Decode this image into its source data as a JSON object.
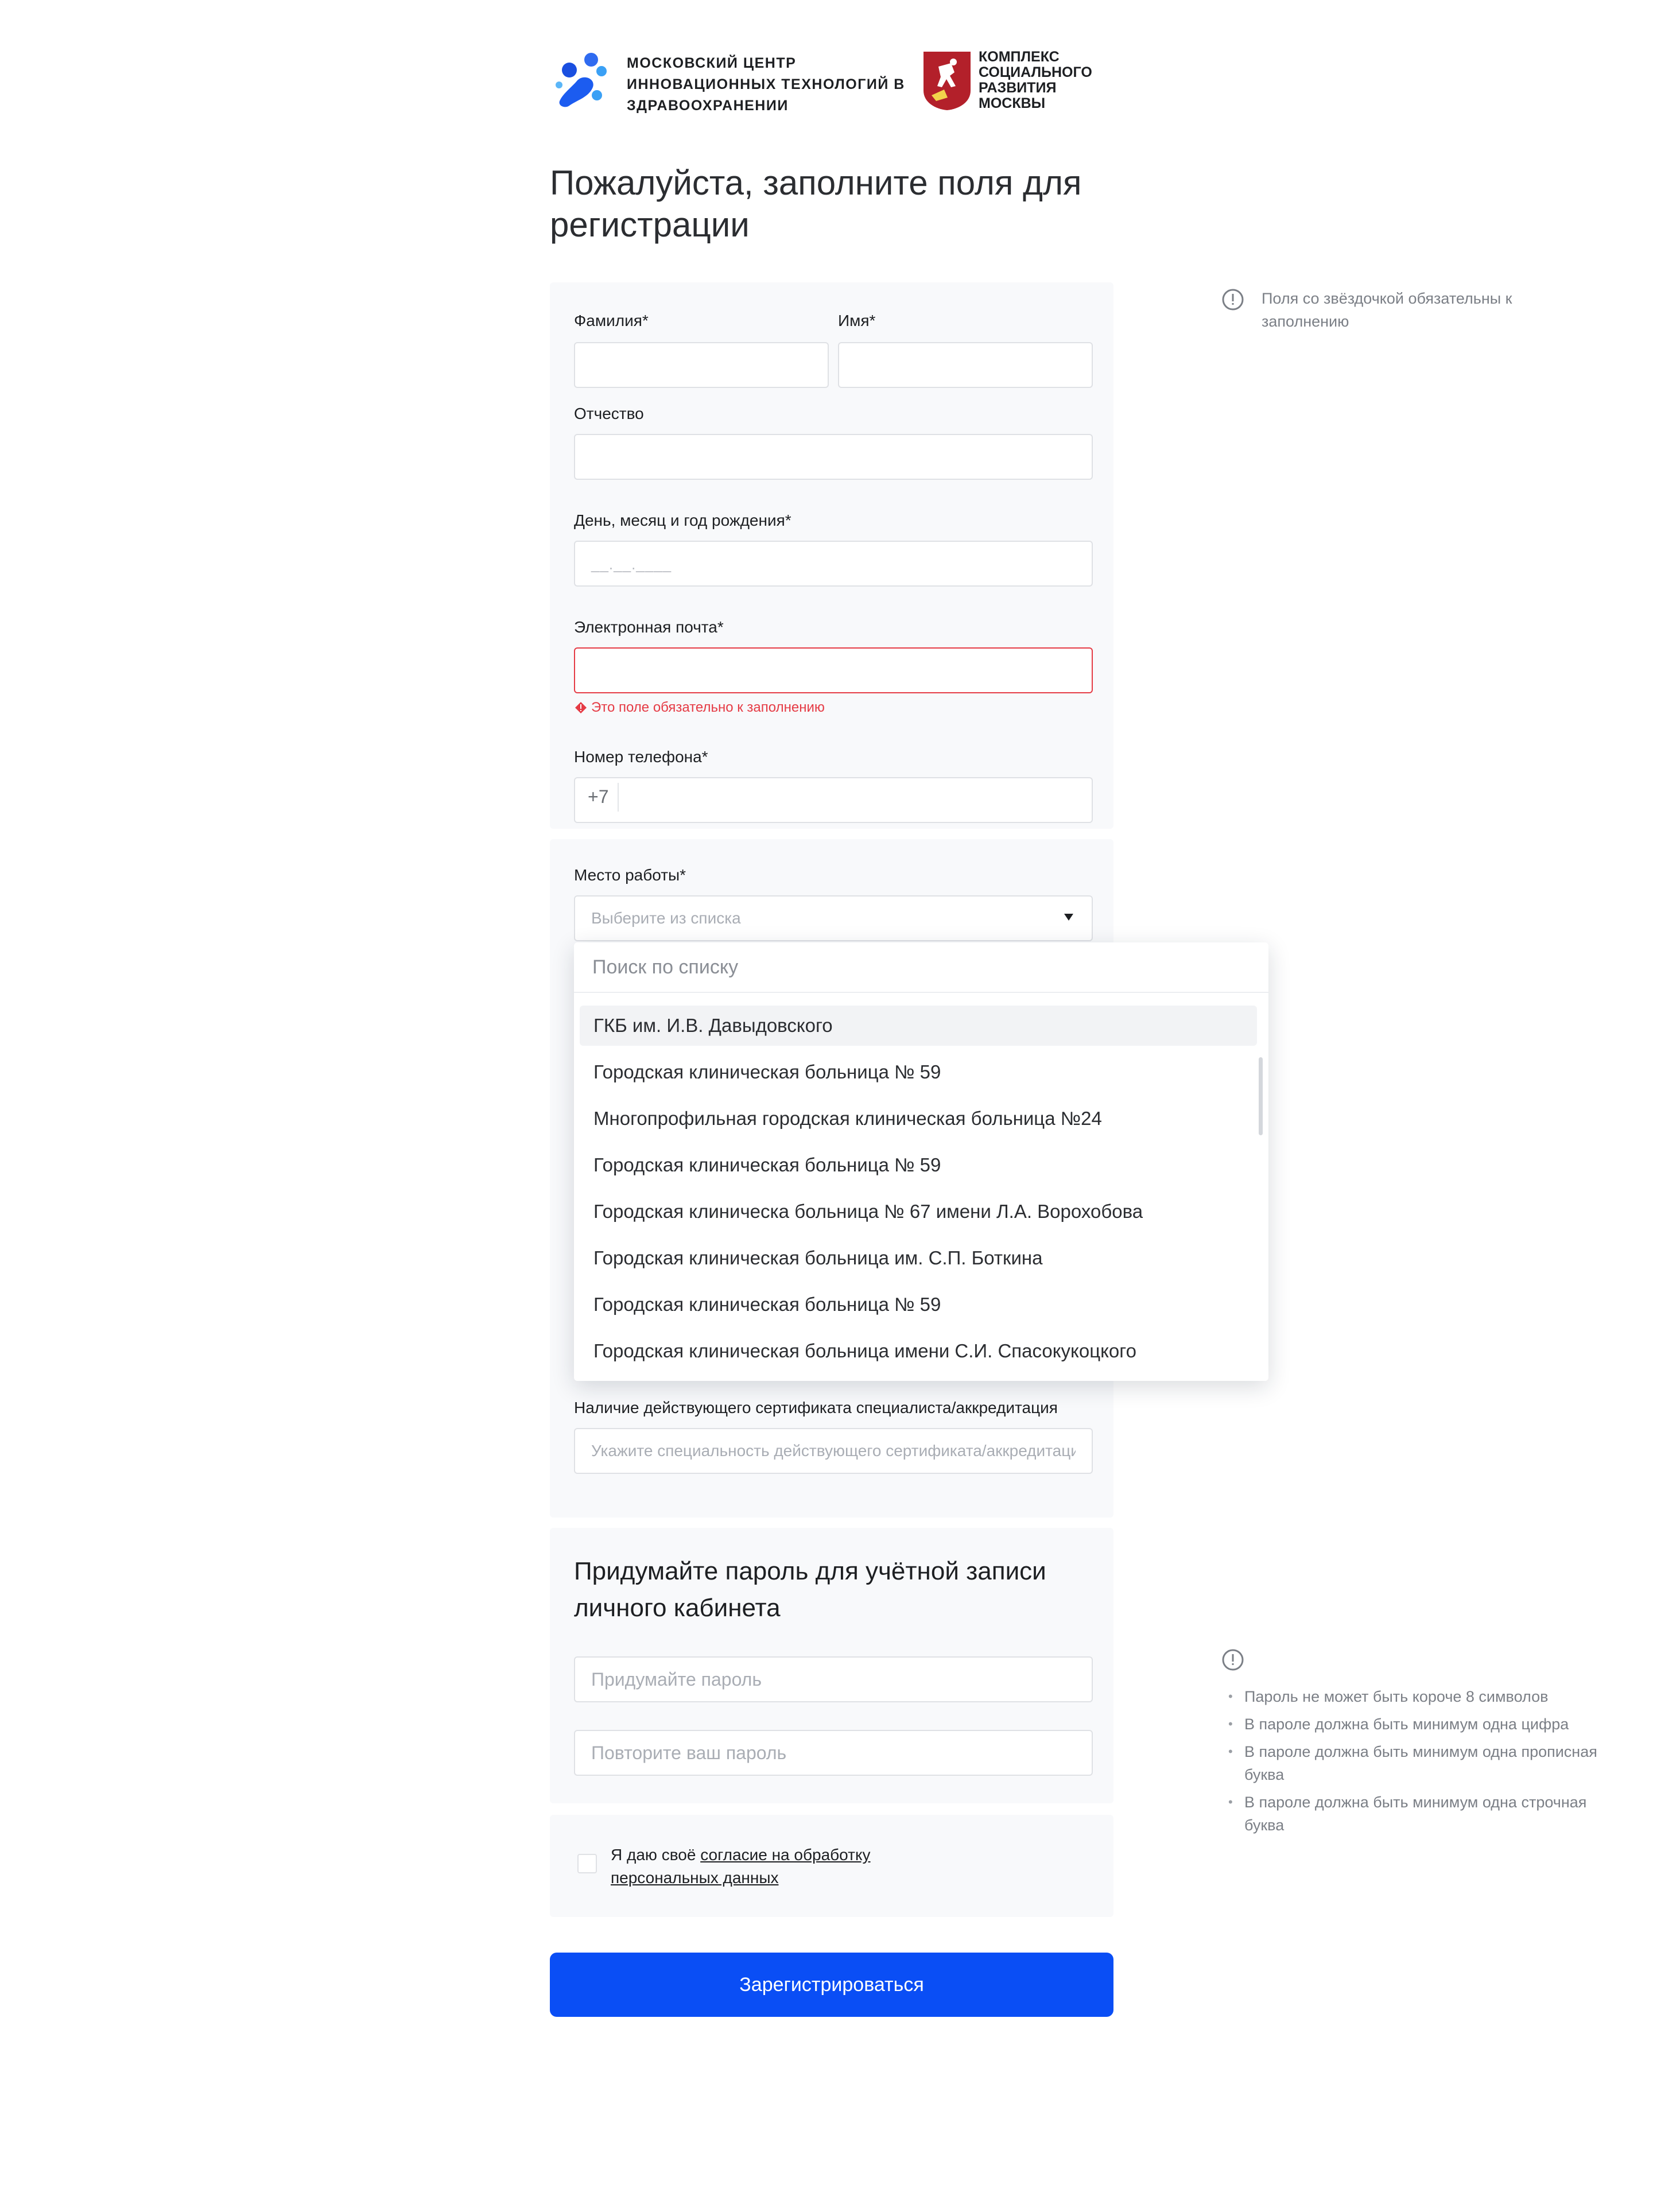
{
  "header": {
    "mcit_logo_text": "МОСКОВСКИЙ ЦЕНТР ИННОВАЦИОННЫХ ТЕХНОЛОГИЙ В ЗДРАВООХРАНЕНИИ",
    "ksr_logo_text": "КОМПЛЕКС СОЦИАЛЬНОГО РАЗВИТИЯ МОСКВЫ"
  },
  "title": "Пожалуйста, заполните поля для регистрации",
  "form": {
    "last_name_label": "Фамилия*",
    "first_name_label": "Имя*",
    "middle_name_label": "Отчество",
    "birth_date_label": "День, месяц и год рождения*",
    "birth_date_mask": "__.__.____",
    "email_label": "Электронная почта*",
    "email_error": "Это поле обязательно к заполнению",
    "phone_label": "Номер телефона*",
    "phone_prefix": "+7",
    "workplace_label": "Место работы*",
    "workplace_placeholder": "Выберите из списка",
    "certificate_label": "Наличие действующего сертификата специалиста/аккредитация",
    "certificate_placeholder": "Укажите специальность действующего сертификата/аккредитации"
  },
  "dropdown": {
    "search_placeholder": "Поиск по списку",
    "items": [
      "ГКБ им. И.В. Давыдовского",
      "Городская клиническая больница № 59",
      "Многопрофильная городская клиническая больница №24",
      "Городская клиническая больница № 59",
      "Городская клиническа больница № 67 имени Л.А. Ворохобова",
      "Городская клиническая больница им. С.П. Боткина",
      "Городская клиническая больница № 59",
      "Городская клиническая больница имени С.И. Спасокукоцкого"
    ]
  },
  "password": {
    "title": "Придумайте пароль для учётной записи личного кабинета",
    "password_placeholder": "Придумайте пароль",
    "repeat_placeholder": "Повторите ваш пароль"
  },
  "consent": {
    "prefix": "Я даю своё ",
    "link": "согласие на обработку персональных данных"
  },
  "submit_label": "Зарегистрироваться",
  "hints": {
    "required_note": "Поля со звёздочкой обязательны к заполнению",
    "password_rules": [
      "Пароль не может быть короче 8 символов",
      "В пароле должна быть минимум одна цифра",
      "В пароле должна быть минимум одна прописная буква",
      "В пароле должна быть минимум одна строчная буква"
    ]
  },
  "colors": {
    "accent": "#0a4ef5",
    "error": "#e53b45",
    "card_bg": "#f8f9fb"
  }
}
